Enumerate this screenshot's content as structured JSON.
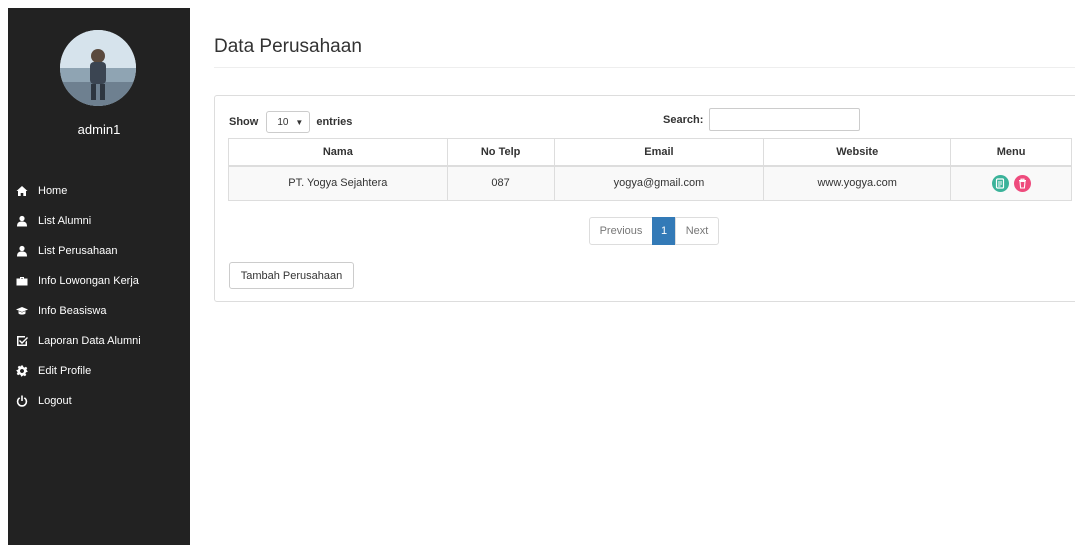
{
  "sidebar": {
    "user_name": "admin1",
    "items": [
      {
        "label": "Home",
        "icon": "home-icon"
      },
      {
        "label": "List Alumni",
        "icon": "user-icon"
      },
      {
        "label": "List Perusahaan",
        "icon": "user-icon"
      },
      {
        "label": "Info Lowongan Kerja",
        "icon": "briefcase-icon"
      },
      {
        "label": "Info Beasiswa",
        "icon": "graduation-cap-icon"
      },
      {
        "label": "Laporan Data Alumni",
        "icon": "check-square-icon"
      },
      {
        "label": "Edit Profile",
        "icon": "gear-icon"
      },
      {
        "label": "Logout",
        "icon": "power-icon"
      }
    ]
  },
  "page": {
    "title": "Data Perusahaan"
  },
  "table_controls": {
    "show_label": "Show",
    "entries_value": "10",
    "entries_label": "entries",
    "search_label": "Search:",
    "search_value": ""
  },
  "table": {
    "headers": [
      "Nama",
      "No Telp",
      "Email",
      "Website",
      "Menu"
    ],
    "rows": [
      {
        "nama": "PT. Yogya Sejahtera",
        "telp": "087",
        "email": "yogya@gmail.com",
        "website": "www.yogya.com"
      }
    ]
  },
  "pagination": {
    "previous": "Previous",
    "current": "1",
    "next": "Next"
  },
  "actions": {
    "add_label": "Tambah Perusahaan"
  },
  "colors": {
    "sidebar_bg": "#222222",
    "active_page": "#337ab7",
    "edit_button": "#3bb39a",
    "delete_button": "#ee4b7d"
  }
}
